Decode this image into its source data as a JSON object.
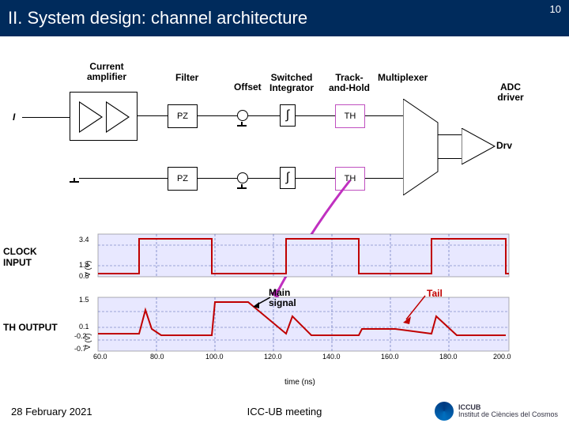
{
  "page_number": "10",
  "title": "II. System design: channel architecture",
  "stages": {
    "current_amp": "Current\namplifier",
    "filter": "Filter",
    "offset": "Offset",
    "switched_int": "Switched\nIntegrator",
    "track_hold": "Track-\nand-Hold",
    "multiplexer": "Multiplexer",
    "adc_driver": "ADC\ndriver",
    "drv": "Drv"
  },
  "blocks": {
    "input_label": "I",
    "pz": "PZ",
    "integral": "∫",
    "th": "TH"
  },
  "chart_labels": {
    "clock": "CLOCK\nINPUT",
    "th_out": "TH OUTPUT",
    "yaxis": "V (V)",
    "xaxis": "time (ns)"
  },
  "annotations": {
    "main_signal": "Main\nsignal",
    "tail": "Tail"
  },
  "footer": {
    "date": "28 February 2021",
    "meeting": "ICC-UB meeting",
    "org_top": "ICCUB",
    "org_bottom": "Institut de Ciències del Cosmos"
  },
  "chart_data": [
    {
      "type": "line",
      "title": "CLOCK INPUT",
      "xlabel": "time (ns)",
      "ylabel": "V (V)",
      "ylim": [
        0.5,
        3.4
      ],
      "xlim": [
        60,
        200
      ],
      "x_ticks": [
        60,
        80,
        100,
        120,
        140,
        160,
        180,
        200
      ],
      "y_ticks": [
        0.5,
        1.4,
        3.4
      ],
      "series": [
        {
          "name": "clock",
          "color": "#c00000",
          "x": [
            60,
            74,
            74.2,
            99,
            99.2,
            124,
            124.2,
            149,
            149.2,
            174,
            174.2,
            199,
            199.2,
            200
          ],
          "y": [
            0.5,
            0.5,
            3.3,
            3.3,
            0.5,
            0.5,
            3.3,
            3.3,
            0.5,
            0.5,
            3.3,
            3.3,
            0.5,
            0.5
          ]
        }
      ]
    },
    {
      "type": "line",
      "title": "TH OUTPUT",
      "xlabel": "time (ns)",
      "ylabel": "V (V)",
      "ylim": [
        -0.7,
        1.5
      ],
      "xlim": [
        60,
        200
      ],
      "x_ticks": [
        60,
        80,
        100,
        120,
        140,
        160,
        180,
        200
      ],
      "y_ticks": [
        -0.7,
        -0.2,
        0.1,
        1.5
      ],
      "series": [
        {
          "name": "th-output",
          "color": "#c00000",
          "x": [
            60,
            74,
            78,
            82,
            86,
            99,
            101,
            112,
            124,
            128,
            134,
            149,
            151,
            162,
            174,
            178,
            184,
            199,
            200
          ],
          "y": [
            -0.2,
            -0.2,
            0.8,
            0.1,
            -0.1,
            -0.1,
            1.3,
            1.3,
            -0.2,
            0.5,
            -0.1,
            -0.1,
            0.2,
            0.2,
            -0.2,
            0.5,
            -0.1,
            -0.1,
            0.2
          ]
        }
      ]
    }
  ]
}
